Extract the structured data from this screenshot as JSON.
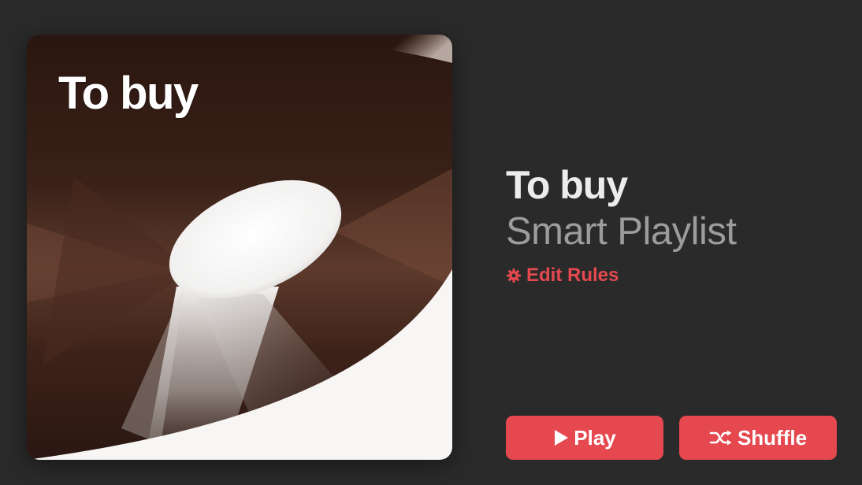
{
  "artwork": {
    "title": "To buy",
    "icon": "cd-disc-artwork"
  },
  "header": {
    "title": "To buy",
    "subtitle": "Smart Playlist",
    "edit_rules_label": "Edit Rules",
    "edit_rules_icon": "gear-icon"
  },
  "actions": {
    "play_label": "Play",
    "play_icon": "play-icon",
    "shuffle_label": "Shuffle",
    "shuffle_icon": "shuffle-icon"
  },
  "colors": {
    "background": "#2a2a2a",
    "accent": "#e5484f",
    "title": "#ececec",
    "subtitle": "#9c9c9c",
    "artwork_dark": "#2a1711",
    "artwork_mid": "#5e3a2c",
    "artwork_light": "#f7f6f4"
  }
}
